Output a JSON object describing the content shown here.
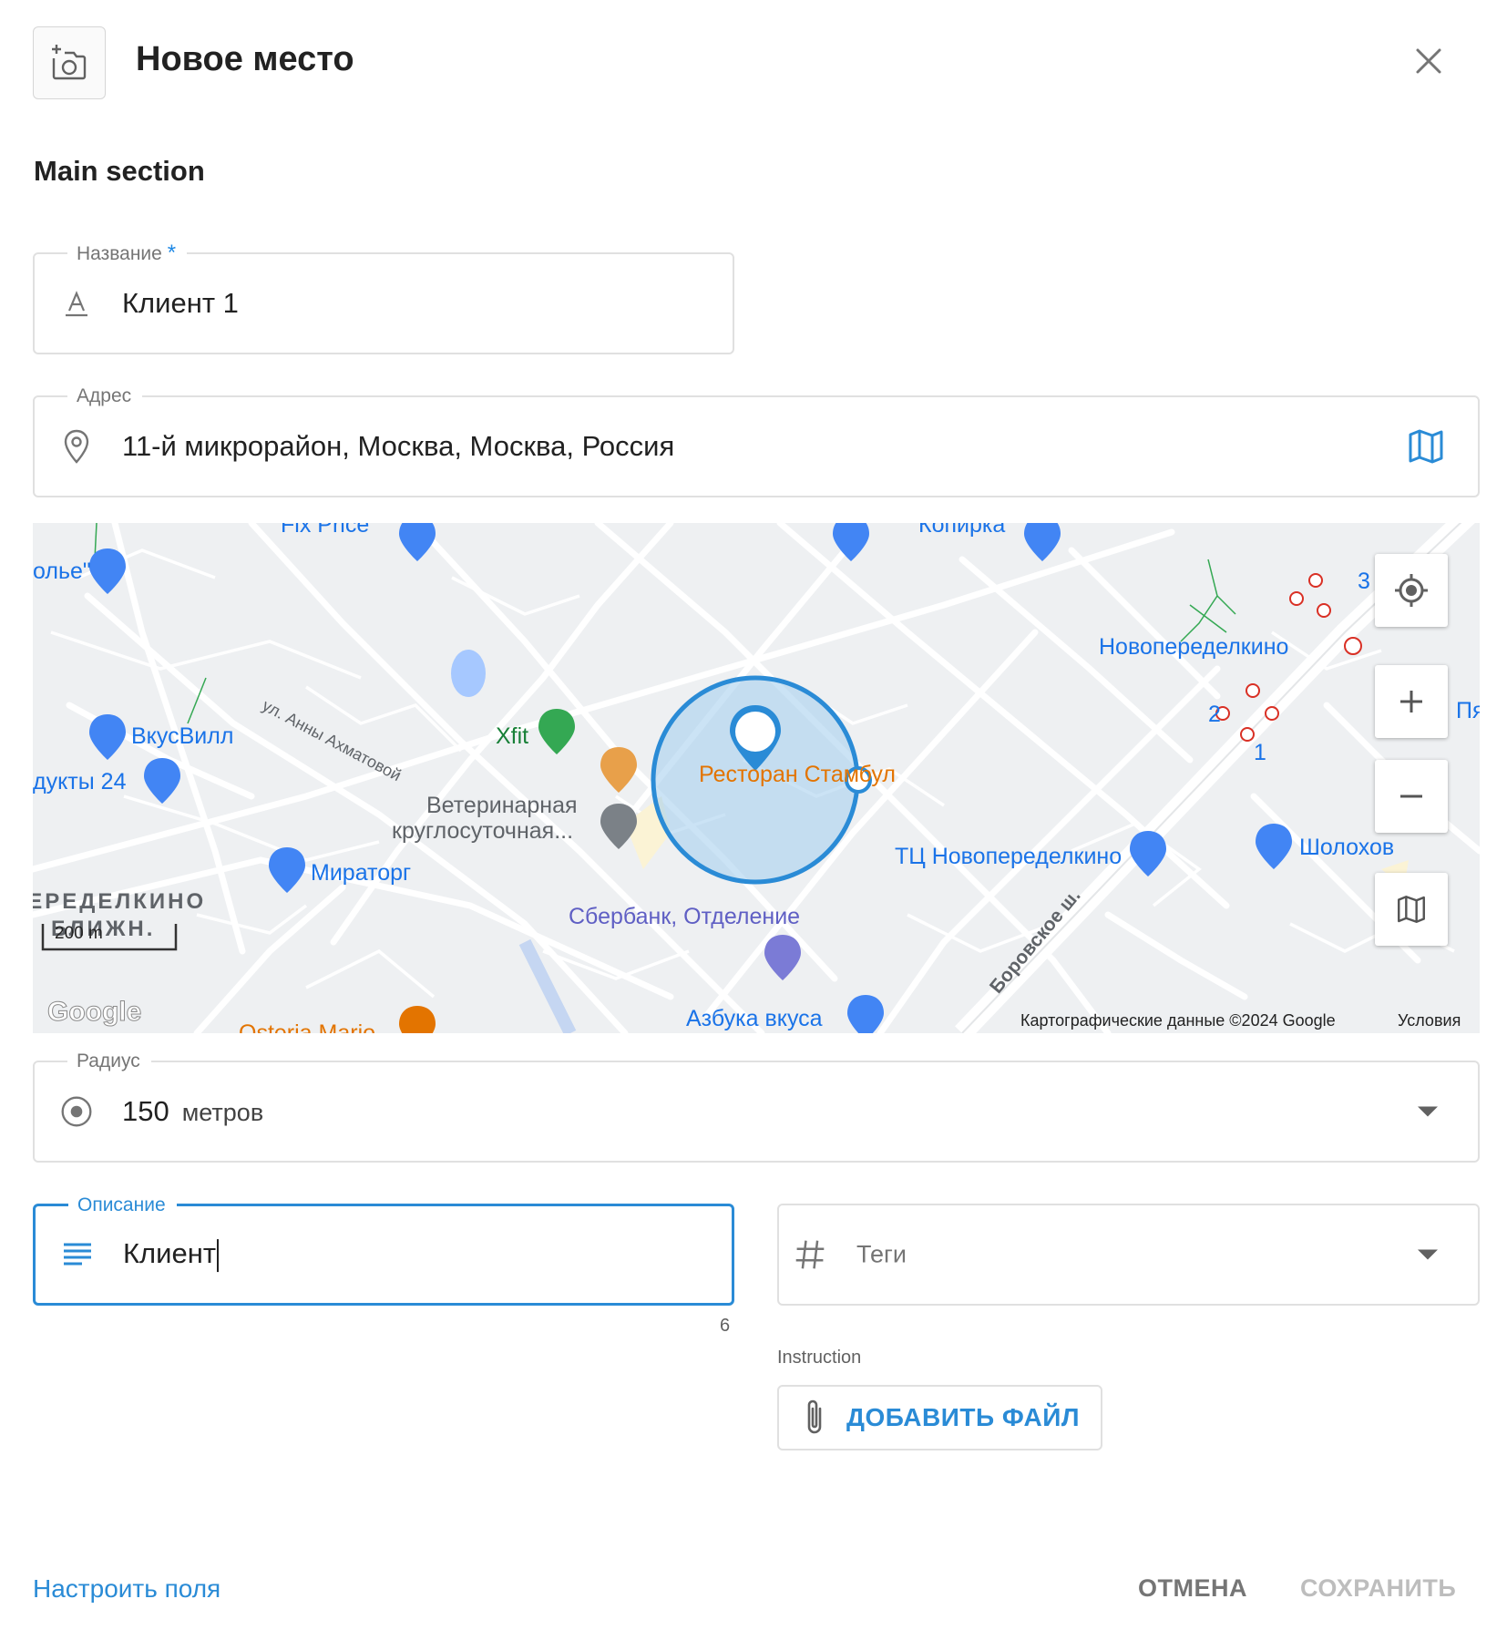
{
  "header": {
    "title": "Новое место",
    "photo_icon": "add-photo-icon",
    "close_icon": "close-icon"
  },
  "main": {
    "section_title": "Main section"
  },
  "fields": {
    "name": {
      "label": "Название",
      "required_mark": "*",
      "value": "Клиент 1",
      "icon": "text-format-icon"
    },
    "address": {
      "label": "Адрес",
      "value": "11-й микрорайон, Москва, Москва, Россия",
      "icon": "location-pin-icon",
      "action_icon": "map-icon"
    },
    "radius": {
      "label": "Радиус",
      "value": "150",
      "unit": "метров",
      "icon": "radio-target-icon"
    },
    "description": {
      "label": "Описание",
      "value": "Клиент",
      "counter": "6",
      "icon": "notes-icon"
    },
    "tags": {
      "placeholder": "Теги",
      "icon": "hashtag-icon"
    }
  },
  "instruction": {
    "label": "Instruction",
    "add_file_label": "ДОБАВИТЬ ФАЙЛ",
    "icon": "paperclip-icon"
  },
  "footer": {
    "configure_label": "Настроить поля",
    "cancel_label": "ОТМЕНА",
    "save_label": "СОХРАНИТЬ"
  },
  "map": {
    "labels": {
      "poi_top1": "Fix Price",
      "poi_top2": "Копирка",
      "poi_left1": "олье\"",
      "vkusvill": "ВкусВилл",
      "produkty": "дукты 24",
      "street_akhmatova": "ул. Анны Ахматовой",
      "xfit": "Xfit",
      "restaurant": "Ресторан Стамбул",
      "vet_line1": "Ветеринарная",
      "vet_line2": "круглосуточная...",
      "miratorg": "Мираторг",
      "district_line1": "ПЕРЕДЕЛКИНО",
      "district_line2": "БЛИЖН.",
      "sberbank": "Сбербанк, Отделение",
      "azbuka": "Азбука вкуса",
      "osteria": "Osteria Mario",
      "novoperedelkino": "Новопеределкино",
      "tc": "ТЦ Новопеределкино",
      "sholokhov": "Шолохов",
      "borovskoe": "Боровское ш.",
      "metro_3": "3",
      "metro_2": "2",
      "metro_1": "1",
      "metro_py": "Пя",
      "scale": "200 m",
      "google": "Google",
      "copyright": "Картографические данные ©2024 Google",
      "terms": "Условия"
    },
    "controls": {
      "locate": "my-location-icon",
      "zoom_in": "plus-icon",
      "zoom_out": "minus-icon",
      "layers": "map-icon"
    },
    "colors": {
      "circle_stroke": "#2a8bd6",
      "circle_fill": "#a9d0ef"
    }
  },
  "colors": {
    "accent": "#2a8bd6",
    "text": "#212121",
    "muted": "#757575",
    "border": "#e0e0e0"
  }
}
